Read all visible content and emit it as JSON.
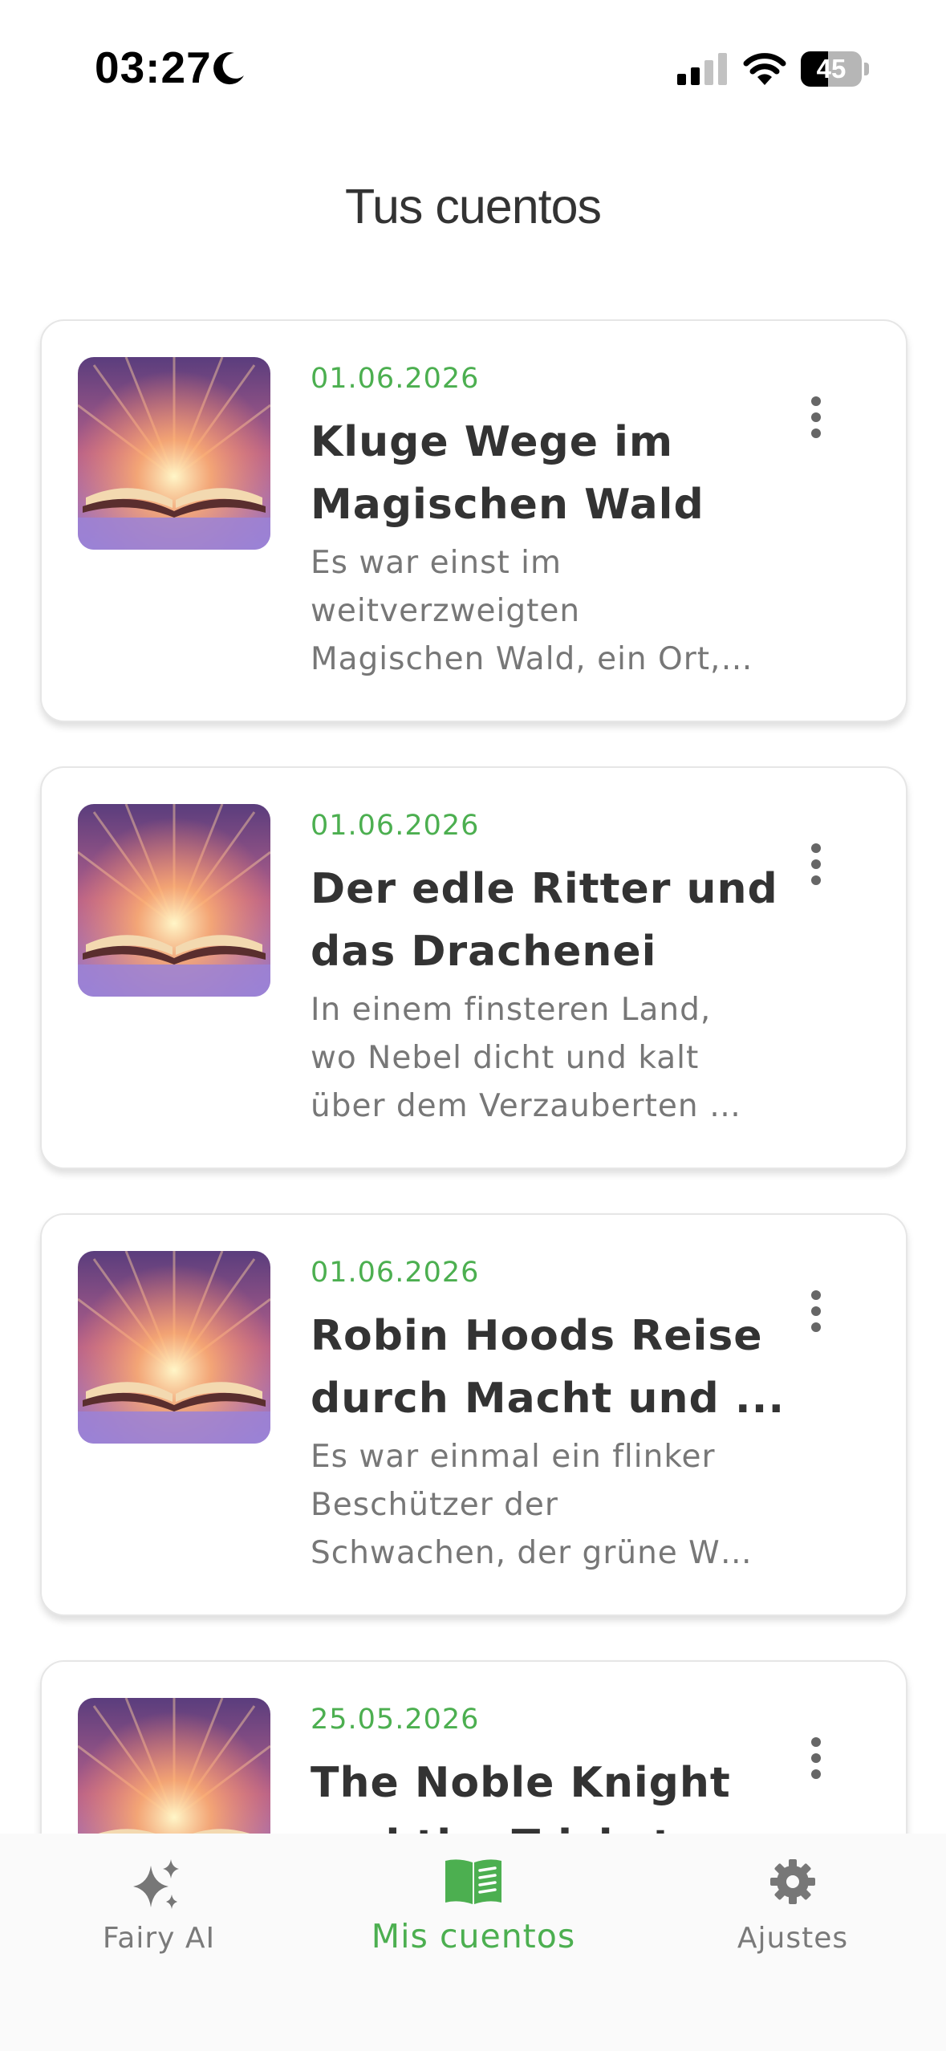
{
  "status_bar": {
    "time": "03:27",
    "battery_level": "45",
    "battery_fraction": 0.45,
    "icons": [
      "moon-icon",
      "signal-icon",
      "wifi-icon",
      "battery-icon"
    ]
  },
  "header": {
    "title": "Tus cuentos"
  },
  "stories": [
    {
      "date": "01.06.2026",
      "title_lines": [
        "Kluge Wege im",
        "Magischen Wald"
      ],
      "excerpt_lines": [
        "Es war einst im",
        "weitverzweigten",
        "Magischen Wald, ein Ort,…"
      ],
      "menu_icon": "more-vertical-icon"
    },
    {
      "date": "01.06.2026",
      "title_lines": [
        "Der edle Ritter und",
        "das Drachenei"
      ],
      "excerpt_lines": [
        "In einem finsteren Land,",
        "wo Nebel dicht und kalt",
        "über dem Verzauberten …"
      ],
      "menu_icon": "more-vertical-icon"
    },
    {
      "date": "01.06.2026",
      "title_lines": [
        "Robin Hoods Reise",
        "durch Macht und ..."
      ],
      "excerpt_lines": [
        "Es war einmal ein flinker",
        "Beschützer der",
        "Schwachen, der grüne W…"
      ],
      "menu_icon": "more-vertical-icon"
    },
    {
      "date": "25.05.2026",
      "title_lines": [
        "The Noble Knight",
        "and the Trickster"
      ],
      "excerpt_lines": [
        "",
        "",
        ""
      ],
      "menu_icon": "more-vertical-icon"
    }
  ],
  "tab_bar": {
    "tabs": [
      {
        "label": "Fairy AI",
        "icon": "sparkles-icon",
        "active": false
      },
      {
        "label": "Mis cuentos",
        "icon": "book-icon",
        "active": true
      },
      {
        "label": "Ajustes",
        "icon": "gear-icon",
        "active": false
      }
    ]
  },
  "colors": {
    "accent": "#4caf50",
    "title_text": "#333333",
    "excerpt_text": "#777777",
    "tab_inactive": "#7a7a7a",
    "card_border": "#e6e6e6"
  }
}
